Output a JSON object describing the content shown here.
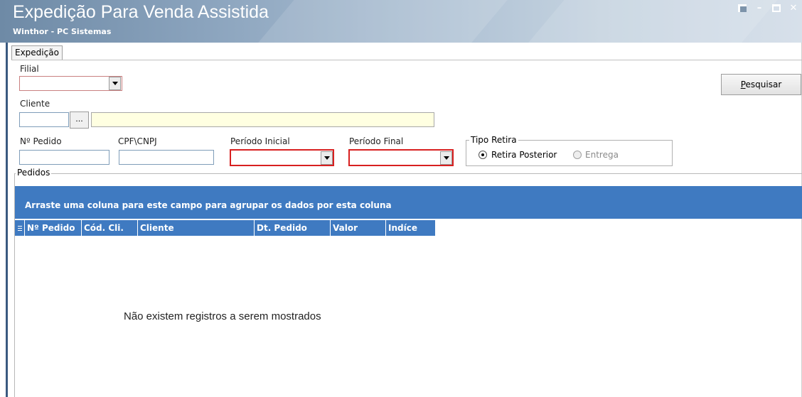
{
  "window": {
    "title": "Expedição Para Venda Assistida",
    "subtitle": "Winthor - PC Sistemas",
    "controls": [
      "restore",
      "minimize",
      "maximize",
      "close"
    ],
    "minimize_glyph": "–",
    "close_glyph": "✕"
  },
  "tabs": [
    {
      "label": "Expedição"
    }
  ],
  "form": {
    "filial_label": "Filial",
    "filial_value": "",
    "cliente_label": "Cliente",
    "cliente_code": "",
    "cliente_lookup_label": "...",
    "cliente_name": "",
    "pedido_label": "Nº Pedido",
    "pedido_value": "",
    "cpf_label": "CPF\\CNPJ",
    "cpf_value": "",
    "periodo_inicial_label": "Período Inicial",
    "periodo_inicial_value": "",
    "periodo_final_label": "Período Final",
    "periodo_final_value": ""
  },
  "search_button": {
    "mnemonic": "P",
    "rest": "esquisar"
  },
  "tipo_retira": {
    "title": "Tipo Retira",
    "options": [
      {
        "label": "Retira Posterior",
        "checked": true,
        "enabled": true
      },
      {
        "label": "Entrega",
        "checked": false,
        "enabled": false
      }
    ]
  },
  "pedidos": {
    "title": "Pedidos",
    "group_hint": "Arraste uma coluna para este campo para agrupar os dados por esta coluna",
    "columns": [
      "Nº Pedido",
      "Cód. Cli.",
      "Cliente",
      "Dt. Pedido",
      "Valor",
      "Indíce"
    ],
    "empty_message": "Não existem registros a serem mostrados"
  },
  "colors": {
    "grid_blue": "#3f7ac1",
    "required_red": "#d82020",
    "highlight_yellow": "#ffffe1"
  }
}
